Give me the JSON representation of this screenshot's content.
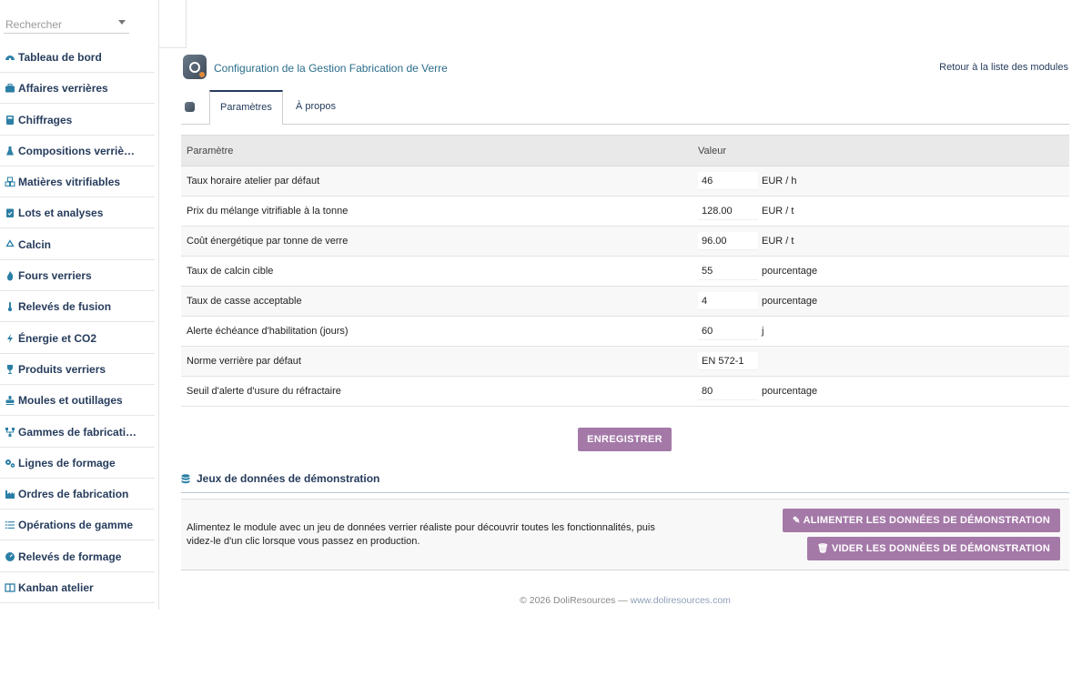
{
  "sidebar": {
    "search_placeholder": "Rechercher",
    "items": [
      {
        "label": "Tableau de bord",
        "icon": "dashboard-icon"
      },
      {
        "label": "Affaires verrières",
        "icon": "briefcase-icon"
      },
      {
        "label": "Chiffrages",
        "icon": "calculator-icon"
      },
      {
        "label": "Compositions verriè…",
        "icon": "flask-icon"
      },
      {
        "label": "Matières vitrifiables",
        "icon": "cubes-icon"
      },
      {
        "label": "Lots et analyses",
        "icon": "clipboard-check-icon"
      },
      {
        "label": "Calcin",
        "icon": "recycle-icon"
      },
      {
        "label": "Fours verriers",
        "icon": "fire-icon"
      },
      {
        "label": "Relevés de fusion",
        "icon": "thermometer-icon"
      },
      {
        "label": "Énergie et CO2",
        "icon": "bolt-icon"
      },
      {
        "label": "Produits verriers",
        "icon": "wine-glass-icon"
      },
      {
        "label": "Moules et outillages",
        "icon": "stamp-icon"
      },
      {
        "label": "Gammes de fabricati…",
        "icon": "sitemap-icon"
      },
      {
        "label": "Lignes de formage",
        "icon": "cogs-icon"
      },
      {
        "label": "Ordres de fabrication",
        "icon": "industry-icon"
      },
      {
        "label": "Opérations de gamme",
        "icon": "list-icon"
      },
      {
        "label": "Relevés de formage",
        "icon": "gauge-icon"
      },
      {
        "label": "Kanban atelier",
        "icon": "columns-icon"
      }
    ]
  },
  "header": {
    "title": "Configuration de la Gestion Fabrication de Verre",
    "back_link": "Retour à la liste des modules"
  },
  "tabs": [
    {
      "label": "Paramètres",
      "active": true
    },
    {
      "label": "À propos",
      "active": false
    }
  ],
  "table": {
    "col_param": "Paramètre",
    "col_value": "Valeur",
    "rows": [
      {
        "label": "Taux horaire atelier par défaut",
        "value": "46",
        "unit": "EUR / h"
      },
      {
        "label": "Prix du mélange vitrifiable à la tonne",
        "value": "128.00",
        "unit": "EUR / t"
      },
      {
        "label": "Coût énergétique par tonne de verre",
        "value": "96.00",
        "unit": "EUR / t"
      },
      {
        "label": "Taux de calcin cible",
        "value": "55",
        "unit": "pourcentage"
      },
      {
        "label": "Taux de casse acceptable",
        "value": "4",
        "unit": "pourcentage"
      },
      {
        "label": "Alerte échéance d'habilitation (jours)",
        "value": "60",
        "unit": "j"
      },
      {
        "label": "Norme verrière par défaut",
        "value": "EN 572-1",
        "unit": ""
      },
      {
        "label": "Seuil d'alerte d'usure du réfractaire",
        "value": "80",
        "unit": "pourcentage"
      }
    ]
  },
  "save_label": "ENREGISTRER",
  "demo": {
    "title": "Jeux de données de démonstration",
    "description": "Alimentez le module avec un jeu de données verrier réaliste pour découvrir toutes les fonctionnalités, puis videz-le d'un clic lorsque vous passez en production.",
    "feed_label": "ALIMENTER LES DONNÉES DE DÉMONSTRATION",
    "clear_label": "VIDER LES DONNÉES DE DÉMONSTRATION"
  },
  "footer": {
    "copyright": "© 2026 DoliResources — ",
    "link": "www.doliresources.com"
  },
  "colors": {
    "accent": "#a479a8",
    "nav_text": "#263c5c",
    "title": "#2b6d8a",
    "icon": "#2b7fa6"
  }
}
